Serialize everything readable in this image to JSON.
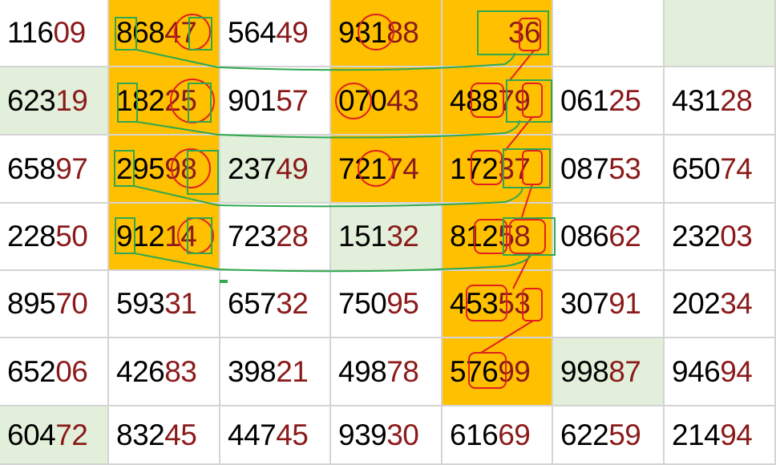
{
  "colors": {
    "highlight_orange": "#ffc000",
    "highlight_green": "#e2efda",
    "digits_black": "#000000",
    "digits_red": "#8b1a1a",
    "annotation_red": "#e02020",
    "annotation_green": "#2fa84f"
  },
  "grid": {
    "rows": [
      [
        {
          "pre": "116",
          "suf": "09",
          "bg": "white"
        },
        {
          "pre": "868",
          "suf": "47",
          "bg": "orange"
        },
        {
          "pre": "564",
          "suf": "49",
          "bg": "white"
        },
        {
          "pre": "931",
          "suf": "88",
          "bg": "orange"
        },
        {
          "pre": "",
          "suf": "36",
          "bg": "orange"
        },
        {
          "pre": "",
          "suf": "",
          "bg": "white"
        },
        {
          "pre": "",
          "suf": "",
          "bg": "green"
        }
      ],
      [
        {
          "pre": "623",
          "suf": "19",
          "bg": "green"
        },
        {
          "pre": "182",
          "suf": "25",
          "bg": "orange"
        },
        {
          "pre": "901",
          "suf": "57",
          "bg": "white"
        },
        {
          "pre": "070",
          "suf": "43",
          "bg": "orange"
        },
        {
          "pre": "488",
          "suf": "79",
          "bg": "orange"
        },
        {
          "pre": "061",
          "suf": "25",
          "bg": "white"
        },
        {
          "pre": "431",
          "suf": "28",
          "bg": "white"
        }
      ],
      [
        {
          "pre": "658",
          "suf": "97",
          "bg": "white"
        },
        {
          "pre": "295",
          "suf": "98",
          "bg": "orange"
        },
        {
          "pre": "237",
          "suf": "49",
          "bg": "green"
        },
        {
          "pre": "721",
          "suf": "74",
          "bg": "orange"
        },
        {
          "pre": "172",
          "suf": "37",
          "bg": "orange"
        },
        {
          "pre": "087",
          "suf": "53",
          "bg": "white"
        },
        {
          "pre": "650",
          "suf": "74",
          "bg": "white"
        }
      ],
      [
        {
          "pre": "228",
          "suf": "50",
          "bg": "white"
        },
        {
          "pre": "912",
          "suf": "14",
          "bg": "orange"
        },
        {
          "pre": "723",
          "suf": "28",
          "bg": "white"
        },
        {
          "pre": "151",
          "suf": "32",
          "bg": "green"
        },
        {
          "pre": "812",
          "suf": "58",
          "bg": "orange"
        },
        {
          "pre": "086",
          "suf": "62",
          "bg": "white"
        },
        {
          "pre": "232",
          "suf": "03",
          "bg": "white"
        }
      ],
      [
        {
          "pre": "895",
          "suf": "70",
          "bg": "white"
        },
        {
          "pre": "593",
          "suf": "31",
          "bg": "white"
        },
        {
          "pre": "657",
          "suf": "32",
          "bg": "white"
        },
        {
          "pre": "750",
          "suf": "95",
          "bg": "white"
        },
        {
          "pre": "453",
          "suf": "53",
          "bg": "orange"
        },
        {
          "pre": "307",
          "suf": "91",
          "bg": "white"
        },
        {
          "pre": "202",
          "suf": "34",
          "bg": "white"
        }
      ],
      [
        {
          "pre": "652",
          "suf": "06",
          "bg": "white"
        },
        {
          "pre": "426",
          "suf": "83",
          "bg": "white"
        },
        {
          "pre": "398",
          "suf": "21",
          "bg": "white"
        },
        {
          "pre": "498",
          "suf": "78",
          "bg": "white"
        },
        {
          "pre": "576",
          "suf": "99",
          "bg": "orange"
        },
        {
          "pre": "998",
          "suf": "87",
          "bg": "green"
        },
        {
          "pre": "946",
          "suf": "94",
          "bg": "white"
        }
      ],
      [
        {
          "pre": "604",
          "suf": "72",
          "bg": "green"
        },
        {
          "pre": "832",
          "suf": "45",
          "bg": "white"
        },
        {
          "pre": "447",
          "suf": "45",
          "bg": "white"
        },
        {
          "pre": "939",
          "suf": "30",
          "bg": "white"
        },
        {
          "pre": "616",
          "suf": "69",
          "bg": "white"
        },
        {
          "pre": "622",
          "suf": "59",
          "bg": "white"
        },
        {
          "pre": "214",
          "suf": "94",
          "bg": "white"
        }
      ]
    ]
  }
}
